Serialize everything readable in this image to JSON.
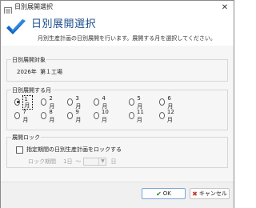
{
  "window": {
    "title": "日別展開選択",
    "close_glyph": "✕"
  },
  "header": {
    "title": "日別展開選択",
    "description": "月別生産計画の日別展開を行います。展開する月を選択してください。"
  },
  "target_group": {
    "legend": "日別展開対象",
    "year": "2026年",
    "factory": "第１工場"
  },
  "month_group": {
    "legend": "日別展開する月",
    "months": [
      {
        "label": "1月",
        "checked": true
      },
      {
        "label": "2月",
        "checked": false
      },
      {
        "label": "3月",
        "checked": false
      },
      {
        "label": "4月",
        "checked": false
      },
      {
        "label": "5月",
        "checked": false
      },
      {
        "label": "6月",
        "checked": false
      },
      {
        "label": "7月",
        "checked": false
      },
      {
        "label": "8月",
        "checked": false
      },
      {
        "label": "9月",
        "checked": false
      },
      {
        "label": "10月",
        "checked": false
      },
      {
        "label": "11月",
        "checked": false
      },
      {
        "label": "12月",
        "checked": false
      }
    ],
    "selected": "1月"
  },
  "lock_group": {
    "legend": "展開ロック",
    "checkbox_label": "指定期間の日別生産計画をロックする",
    "checkbox_checked": false,
    "period_label": "ロック期間",
    "from_text": "1日",
    "tilde": "～",
    "to_value": "",
    "day_unit": "日"
  },
  "footer": {
    "ok_label": "OK",
    "cancel_label": "キャンセル",
    "ok_glyph": "✔",
    "cancel_glyph": "✖"
  },
  "colors": {
    "accent": "#1d4f8c",
    "check_icon_dark": "#1565c0",
    "check_icon_light": "#42a5f5"
  },
  "icons": {
    "app": "app-checklist-icon",
    "header": "checkmark-icon",
    "close": "close-icon",
    "ok": "check-icon",
    "cancel": "cross-icon",
    "combo": "chevron-down-icon"
  }
}
